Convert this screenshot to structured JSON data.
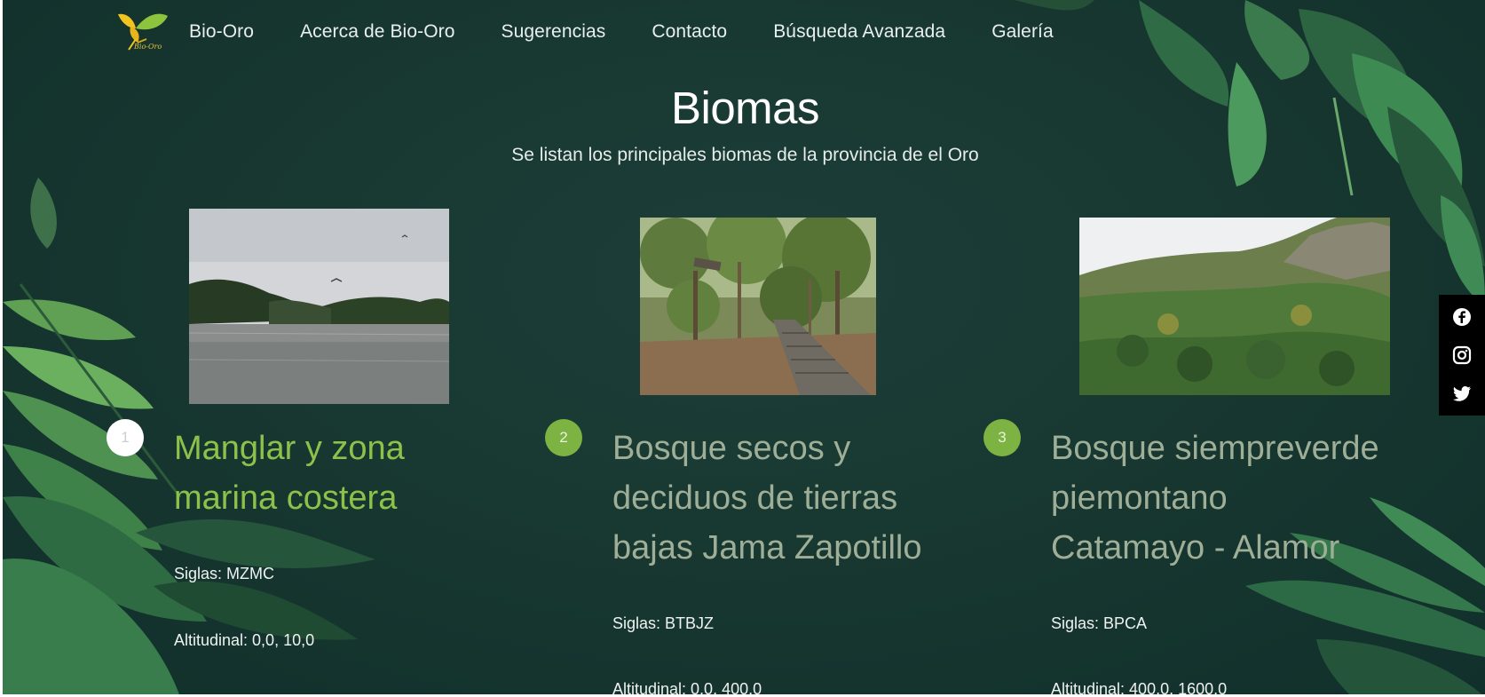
{
  "nav": {
    "logo_text": "Bio-Oro",
    "items": [
      {
        "label": "Bio-Oro"
      },
      {
        "label": "Acerca de Bio-Oro"
      },
      {
        "label": "Sugerencias"
      },
      {
        "label": "Contacto"
      },
      {
        "label": "Búsqueda Avanzada"
      },
      {
        "label": "Galería"
      }
    ]
  },
  "page": {
    "title": "Biomas",
    "subtitle": "Se listan los principales biomas de la provincia de el Oro"
  },
  "biomes": [
    {
      "number": "1",
      "title": "Manglar y zona marina costera",
      "siglas": "Siglas: MZMC",
      "altitudinal": "Altitudinal: 0,0, 10,0",
      "title_color": "#8cc24a"
    },
    {
      "number": "2",
      "title": "Bosque secos y deciduos de tierras bajas Jama Zapotillo",
      "siglas": "Siglas: BTBJZ",
      "altitudinal": "Altitudinal: 0,0, 400,0",
      "title_color": "#9fae96"
    },
    {
      "number": "3",
      "title": "Bosque siempreverde piemontano Catamayo - Alamor",
      "siglas": "Siglas: BPCA",
      "altitudinal": "Altitudinal: 400,0, 1600,0",
      "title_color": "#9fae96"
    }
  ],
  "social": [
    "facebook-icon",
    "instagram-icon",
    "twitter-icon"
  ],
  "colors": {
    "background": "#173630",
    "accent": "#7cb342",
    "nav_text": "#e9efec"
  }
}
